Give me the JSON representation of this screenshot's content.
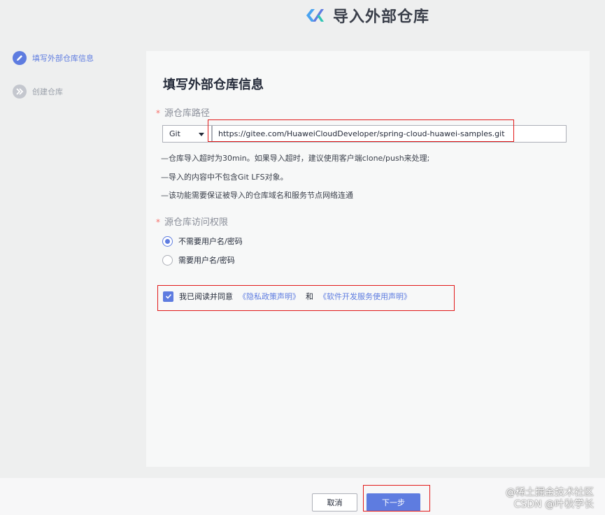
{
  "header": {
    "title": "导入外部仓库",
    "logo_icon": "logo-icon"
  },
  "steps": [
    {
      "label": "填写外部仓库信息",
      "state": "active",
      "icon": "pencil-icon"
    },
    {
      "label": "创建仓库",
      "state": "inactive",
      "icon": "double-chevron-right-icon"
    }
  ],
  "form": {
    "title": "填写外部仓库信息",
    "required_mark": "*",
    "source_path": {
      "label": "源仓库路径",
      "type_value": "Git",
      "url_value": "https://gitee.com/HuaweiCloudDeveloper/spring-cloud-huawei-samples.git"
    },
    "notes": [
      "—仓库导入超时为30min。如果导入超时，建议使用客户端clone/push来处理;",
      "—导入的内容中不包含Git LFS对象。",
      "—该功能需要保证被导入的仓库域名和服务节点网络连通"
    ],
    "access": {
      "label": "源仓库访问权限",
      "options": [
        {
          "label": "不需要用户名/密码",
          "selected": true
        },
        {
          "label": "需要用户名/密码",
          "selected": false
        }
      ]
    },
    "agreement": {
      "checked": true,
      "text": "我已阅读并同意",
      "privacy_link": "《隐私政策声明》",
      "and": "和",
      "service_link": "《软件开发服务使用声明》"
    }
  },
  "footer": {
    "cancel_label": "取消",
    "next_label": "下一步"
  },
  "watermark": {
    "line1": "@稀土掘金技术社区",
    "line2": "CSDN @叶秋学长"
  },
  "colors": {
    "accent": "#5e7ce0",
    "highlight": "#e21a1a",
    "required": "#f66f6a"
  }
}
